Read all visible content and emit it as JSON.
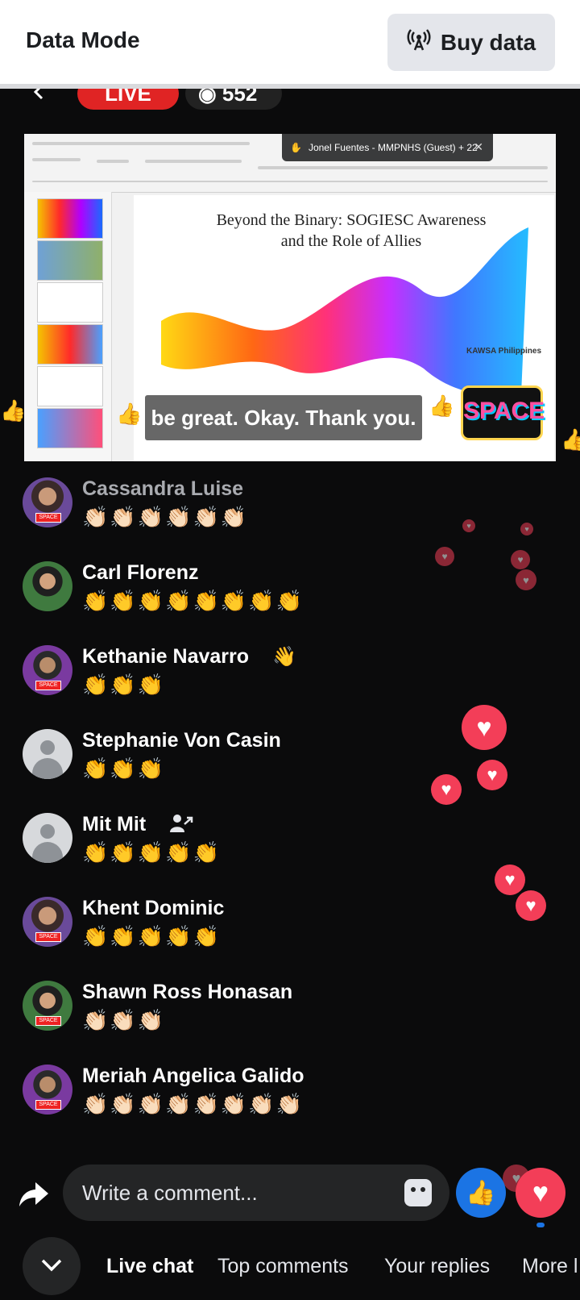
{
  "data_bar": {
    "title": "Data Mode",
    "buy_label": "Buy data"
  },
  "live": {
    "badge": "LIVE",
    "viewers": "552"
  },
  "video": {
    "guest_pill": "Jonel Fuentes - MMPNHS (Guest) + 22",
    "slide_title_line1": "Beyond the Binary: SOGIESC Awareness",
    "slide_title_line2": "and the Role of Allies",
    "slide_footer": "KAWSA Philippines",
    "logo_text": "SPACE",
    "caption": "be great. Okay. Thank you."
  },
  "comments": [
    {
      "name": "Cassandra Luise",
      "text": "👏🏻👏🏻👏🏻👏🏻👏🏻👏🏻",
      "avatar": "photo",
      "dim": true
    },
    {
      "name": "Carl Florenz",
      "text": "👏👏👏👏👏👏👏👏",
      "avatar": "photo2"
    },
    {
      "name": "Kethanie Navarro",
      "text": "👏👏👏",
      "avatar": "photo3",
      "badge_icon": "wave-icon"
    },
    {
      "name": "Stephanie Von Casin",
      "text": "👏👏👏",
      "avatar": "default"
    },
    {
      "name": "Mit Mit",
      "text": "👏👏👏👏👏",
      "avatar": "default",
      "badge_icon": "new-member-icon"
    },
    {
      "name": "Khent Dominic",
      "text": "👏👏👏👏👏",
      "avatar": "photo"
    },
    {
      "name": "Shawn Ross Honasan",
      "text": "👏🏻👏🏻👏🏻",
      "avatar": "photo2"
    },
    {
      "name": "Meriah Angelica Galido",
      "text": "👏🏻👏🏻👏🏻👏🏻👏🏻👏🏻👏🏻👏🏻",
      "avatar": "photo3"
    }
  ],
  "composer": {
    "placeholder": "Write a comment..."
  },
  "tabs": [
    {
      "label": "Live chat",
      "active": true
    },
    {
      "label": "Top comments"
    },
    {
      "label": "Your replies"
    },
    {
      "label": "More l"
    }
  ],
  "colors": {
    "live_red": "#e02424",
    "like_blue": "#1b74e4",
    "love_red": "#f33e58"
  }
}
